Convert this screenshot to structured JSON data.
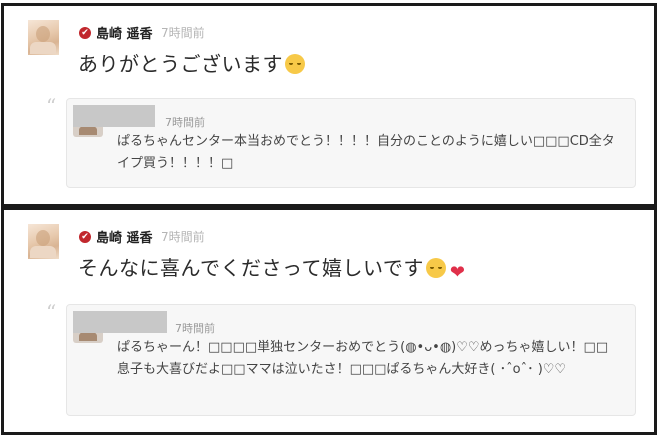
{
  "comments": [
    {
      "author": "島崎 遥香",
      "time": "7時間前",
      "text": "ありがとうございます",
      "emojis": [
        "smiling-face-icon"
      ],
      "reply": {
        "time": "7時間前",
        "text": "ぱるちゃんセンター本当おめでとう！！！！自分のことのように嬉しい□□□CD全タイプ買う！！！！□"
      }
    },
    {
      "author": "島崎 遥香",
      "time": "7時間前",
      "text": "そんなに喜んでくださって嬉しいです",
      "emojis": [
        "smiling-face-icon",
        "heart-icon"
      ],
      "reply": {
        "time": "7時間前",
        "text": "ぱるちゃーん！□□□□単独センターおめでとう(◍•ᴗ•◍)♡♡めっちゃ嬉しい！□□息子も大喜びだよ□□ママは泣いたさ！□□□ぱるちゃん大好き( ･ˆoˆ･ )♡♡"
      }
    }
  ],
  "colors": {
    "verified": "#c1272d",
    "heart": "#e0304a",
    "emoji_face": "#f7c948",
    "reply_background": "#f7f7f7"
  }
}
